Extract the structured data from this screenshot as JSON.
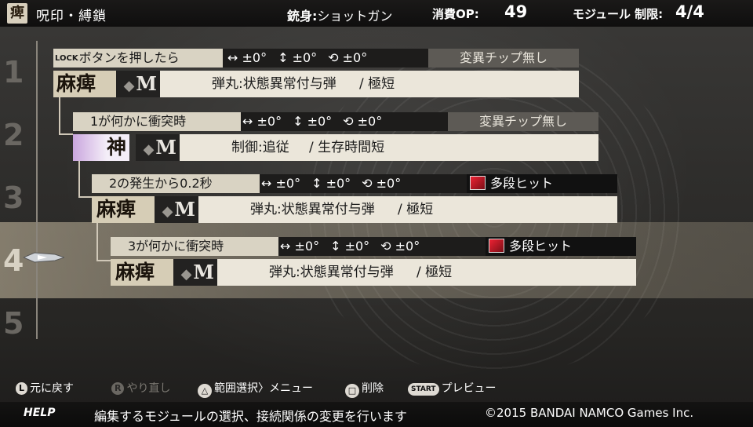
{
  "header": {
    "icon_char": "痺",
    "title": "呪印・縛鎖",
    "weapon_label": "銃身:",
    "weapon_value": "ショットガン",
    "op_label": "消費OP:",
    "op_value": "49",
    "module_limit_label": "モジュール 制限:",
    "module_limit_value": "4/4"
  },
  "row_numbers": [
    "1",
    "2",
    "3",
    "4",
    "5"
  ],
  "selected_row": 4,
  "modules": [
    {
      "trigger": "ボタンを押したら",
      "trigger_prefix": "LOCK",
      "h_angle": "↔ ±0°",
      "v_angle": "↕ ±0°",
      "rot_angle": "⟲ ±0°",
      "chip": "変異チップ無し",
      "chip_type": "none",
      "bullet_name": "麻痺",
      "grade": "M",
      "desc_type": "弾丸:状態異常付与弾",
      "desc_range": "/ 極短"
    },
    {
      "trigger": "1が何かに衝突時",
      "h_angle": "↔ ±0°",
      "v_angle": "↕ ±0°",
      "rot_angle": "⟲ ±0°",
      "chip": "変異チップ無し",
      "chip_type": "none",
      "bullet_name": "神",
      "grade": "M",
      "desc_type": "制御:追従",
      "desc_range": "/ 生存時間短"
    },
    {
      "trigger": "2の発生から0.2秒",
      "h_angle": "↔ ±0°",
      "v_angle": "↕ ±0°",
      "rot_angle": "⟲ ±0°",
      "chip": "多段ヒット",
      "chip_type": "multi",
      "bullet_name": "麻痺",
      "grade": "M",
      "desc_type": "弾丸:状態異常付与弾",
      "desc_range": "/ 極短"
    },
    {
      "trigger": "3が何かに衝突時",
      "h_angle": "↔ ±0°",
      "v_angle": "↕ ±0°",
      "rot_angle": "⟲ ±0°",
      "chip": "多段ヒット",
      "chip_type": "multi",
      "bullet_name": "麻痺",
      "grade": "M",
      "desc_type": "弾丸:状態異常付与弾",
      "desc_range": "/ 極短"
    }
  ],
  "hints": {
    "back_button": "L",
    "back": "元に戻す",
    "redo_button": "R",
    "redo": "やり直し",
    "range_button": "△",
    "range": "範囲選択〉メニュー",
    "delete_button": "□",
    "delete": "削除",
    "preview_button": "START",
    "preview": "プレビュー"
  },
  "footer": {
    "help_label": "HELP",
    "help_text": "編集するモジュールの選択、接続関係の変更を行います",
    "copyright": "©2015 BANDAI NAMCO Games Inc."
  },
  "colors": {
    "selection_band": "#cdc0a5",
    "chip_multi_icon": "#e22233",
    "trigger_bg": "#d9d3c3"
  }
}
